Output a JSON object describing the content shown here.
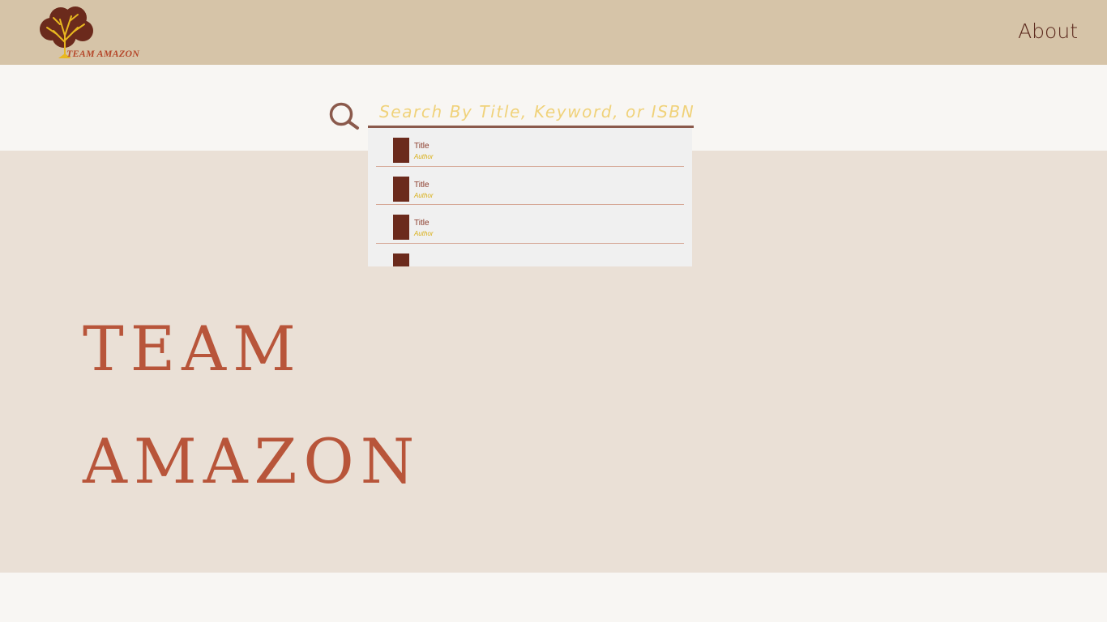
{
  "header": {
    "logo_text": "TEAM AMAZON",
    "about_label": "About"
  },
  "search": {
    "placeholder": "Search By Title, Keyword, or ISBN",
    "icon": "search-icon"
  },
  "suggestions": [
    {
      "title": "Title",
      "author": "Author"
    },
    {
      "title": "Title",
      "author": "Author"
    },
    {
      "title": "Title",
      "author": "Author"
    },
    {
      "title": "",
      "author": ""
    }
  ],
  "hero": {
    "line1": "TEAM",
    "line2": "AMAZON"
  },
  "colors": {
    "header_bg": "#d6c4a8",
    "hero_bg": "#eae0d6",
    "accent": "#b8553a",
    "placeholder": "#f0d27a",
    "cover": "#6b2a1c",
    "author": "#d8ae15"
  }
}
